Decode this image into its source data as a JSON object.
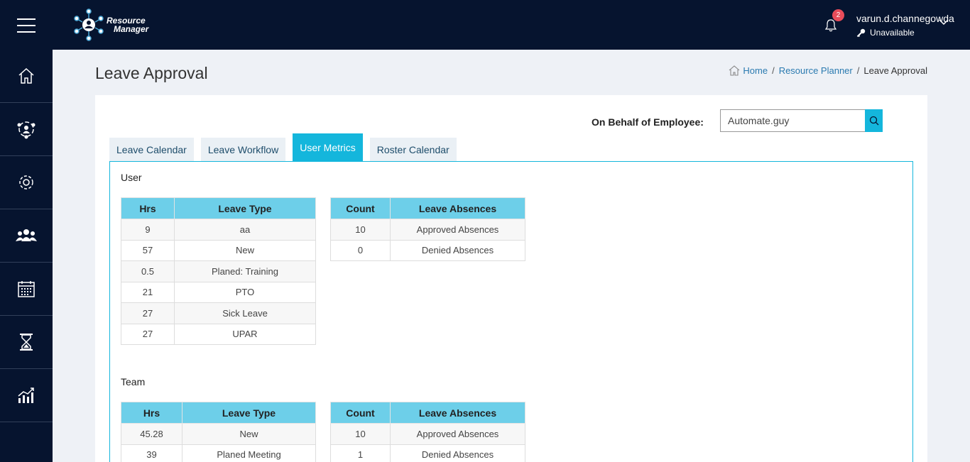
{
  "app": {
    "logo_line1": "Resource",
    "logo_line2": "Manager"
  },
  "header": {
    "notification_count": "2",
    "user_name": "varun.d.channegowda",
    "user_status": "Unavailable"
  },
  "sidebar": {
    "items": [
      {
        "icon": "home-icon"
      },
      {
        "icon": "team-network-icon"
      },
      {
        "icon": "gear-icon"
      },
      {
        "icon": "users-icon"
      },
      {
        "icon": "calendar-icon"
      },
      {
        "icon": "hourglass-icon"
      },
      {
        "icon": "analytics-icon"
      }
    ]
  },
  "page": {
    "title": "Leave Approval",
    "breadcrumb": {
      "home": "Home",
      "parent": "Resource Planner",
      "current": "Leave Approval",
      "sep": "/"
    }
  },
  "behalf": {
    "label": "On Behalf of Employee:",
    "value": "Automate.guy"
  },
  "tabs": [
    "Leave Calendar",
    "Leave Workflow",
    "User Metrics",
    "Roster Calendar"
  ],
  "user_section": {
    "label": "User",
    "leave_headers": [
      "Hrs",
      "Leave Type"
    ],
    "leave_rows": [
      [
        "9",
        "aa"
      ],
      [
        "57",
        "New"
      ],
      [
        "0.5",
        "Planed: Training"
      ],
      [
        "21",
        "PTO"
      ],
      [
        "27",
        "Sick Leave"
      ],
      [
        "27",
        "UPAR"
      ]
    ],
    "absence_headers": [
      "Count",
      "Leave Absences"
    ],
    "absence_rows": [
      [
        "10",
        "Approved Absences"
      ],
      [
        "0",
        "Denied Absences"
      ]
    ]
  },
  "team_section": {
    "label": "Team",
    "leave_headers": [
      "Hrs",
      "Leave Type"
    ],
    "leave_rows": [
      [
        "45.28",
        "New"
      ],
      [
        "39",
        "Planed Meeting"
      ]
    ],
    "absence_headers": [
      "Count",
      "Leave Absences"
    ],
    "absence_rows": [
      [
        "10",
        "Approved Absences"
      ],
      [
        "1",
        "Denied Absences"
      ]
    ]
  },
  "colors": {
    "nav_bg": "#06142f",
    "accent": "#14b6dc",
    "table_header": "#6dcfe9",
    "badge": "#e84c5a"
  }
}
